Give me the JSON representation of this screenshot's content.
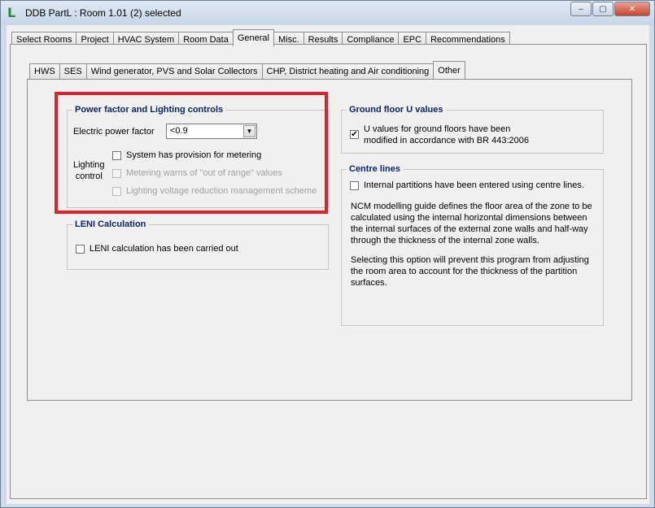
{
  "window": {
    "title": "DDB PartL : Room 1.01 (2) selected",
    "app_icon": "L",
    "minimize_icon": "–",
    "maximize_icon": "▢",
    "close_icon": "✕"
  },
  "tabs": [
    {
      "label": "Select Rooms"
    },
    {
      "label": "Project"
    },
    {
      "label": "HVAC System"
    },
    {
      "label": "Room Data"
    },
    {
      "label": "General",
      "active": true
    },
    {
      "label": "Misc."
    },
    {
      "label": "Results"
    },
    {
      "label": "Compliance"
    },
    {
      "label": "EPC"
    },
    {
      "label": "Recommendations"
    }
  ],
  "subtabs": [
    {
      "label": "HWS"
    },
    {
      "label": "SES"
    },
    {
      "label": "Wind generator, PVS and Solar Collectors"
    },
    {
      "label": "CHP, District heating and Air conditioning"
    },
    {
      "label": "Other",
      "active": true
    }
  ],
  "power_factor": {
    "title": "Power factor and Lighting controls",
    "electric_power_factor_label": "Electric power factor",
    "electric_power_factor_value": "<0.9",
    "lighting_control_label_line1": "Lighting",
    "lighting_control_label_line2": "control",
    "metering_label": "System has provision for metering",
    "metering_warns_label": "Metering warns of \"out of range\" values",
    "voltage_reduction_label": "Lighting voltage reduction management scheme"
  },
  "leni": {
    "title": "LENI Calculation",
    "checkbox_label": "LENI calculation has been carried out"
  },
  "ground_floor": {
    "title": "Ground floor U values",
    "checkbox_line1": "U values for ground floors have been",
    "checkbox_line2": "modified in accordance with BR 443:2006",
    "checked_mark": "✔"
  },
  "centre_lines": {
    "title": "Centre lines",
    "checkbox_label": "Internal partitions have been entered using centre lines.",
    "paragraph1": "NCM modelling guide defines the floor area of the zone to be calculated using the internal horizontal dimensions between the internal surfaces of the external zone walls and half-way through the thickness of the internal zone walls.",
    "paragraph2": "Selecting this option will prevent this program from adjusting the room area to account for the thickness of the partition surfaces."
  },
  "colors": {
    "highlight": "#e0202a",
    "group_title": "#0a246a"
  }
}
